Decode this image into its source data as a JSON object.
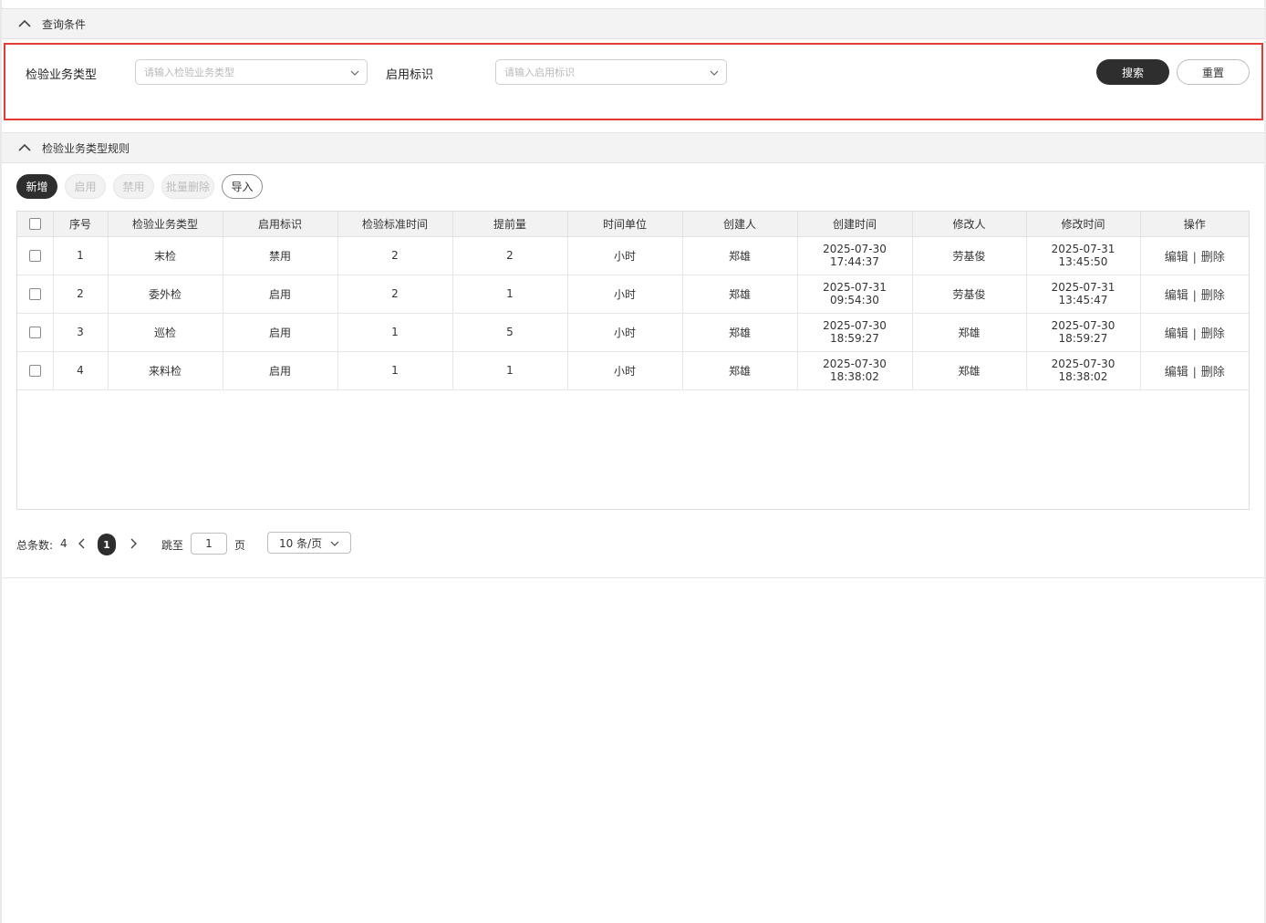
{
  "query_panel": {
    "title": "查询条件",
    "fields": [
      {
        "label": "检验业务类型",
        "placeholder": "请输入检验业务类型"
      },
      {
        "label": "启用标识",
        "placeholder": "请输入启用标识"
      }
    ],
    "search_label": "搜索",
    "reset_label": "重置"
  },
  "rules_panel": {
    "title": "检验业务类型规则",
    "toolbar": {
      "add": "新增",
      "enable": "启用",
      "disable": "禁用",
      "batch_delete": "批量删除",
      "import": "导入"
    },
    "table": {
      "headers": [
        "序号",
        "检验业务类型",
        "启用标识",
        "检验标准时间",
        "提前量",
        "时间单位",
        "创建人",
        "创建时间",
        "修改人",
        "修改时间",
        "操作"
      ],
      "rows": [
        {
          "no": "1",
          "type": "末检",
          "flag": "禁用",
          "std_time": "2",
          "advance": "2",
          "unit": "小时",
          "creator": "郑雄",
          "created": "2025-07-30 17:44:37",
          "modifier": "劳基俊",
          "modified": "2025-07-31 13:45:50"
        },
        {
          "no": "2",
          "type": "委外检",
          "flag": "启用",
          "std_time": "2",
          "advance": "1",
          "unit": "小时",
          "creator": "郑雄",
          "created": "2025-07-31 09:54:30",
          "modifier": "劳基俊",
          "modified": "2025-07-31 13:45:47"
        },
        {
          "no": "3",
          "type": "巡检",
          "flag": "启用",
          "std_time": "1",
          "advance": "5",
          "unit": "小时",
          "creator": "郑雄",
          "created": "2025-07-30 18:59:27",
          "modifier": "郑雄",
          "modified": "2025-07-30 18:59:27"
        },
        {
          "no": "4",
          "type": "来料检",
          "flag": "启用",
          "std_time": "1",
          "advance": "1",
          "unit": "小时",
          "creator": "郑雄",
          "created": "2025-07-30 18:38:02",
          "modifier": "郑雄",
          "modified": "2025-07-30 18:38:02"
        }
      ],
      "op_edit": "编辑",
      "op_sep": "|",
      "op_delete": "删除"
    },
    "pagination": {
      "total_label": "总条数:",
      "total": "4",
      "current_page": "1",
      "jump_label": "跳至",
      "jump_value": "1",
      "page_unit": "页",
      "page_size": "10 条/页"
    }
  },
  "colors": {
    "primary_button": "#2e2e2e",
    "highlight_border": "#e53935",
    "header_bg": "#f3f3f3"
  },
  "icons": {
    "collapse": "chevron-up-icon",
    "dropdown": "chevron-down-icon",
    "prev": "chevron-left-icon",
    "next": "chevron-right-icon"
  }
}
